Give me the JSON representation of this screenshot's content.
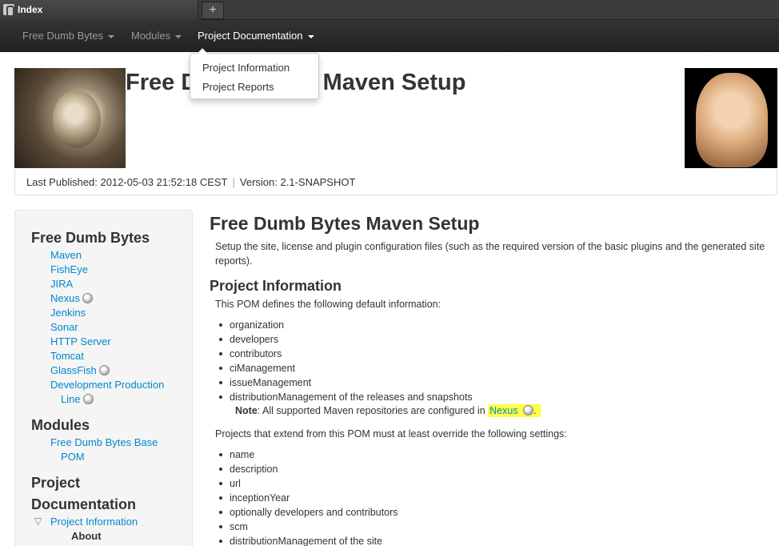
{
  "browser": {
    "tab_title": "Index",
    "new_tab_label": "+"
  },
  "navbar": {
    "items": [
      {
        "label": "Free Dumb Bytes"
      },
      {
        "label": "Modules"
      },
      {
        "label": "Project Documentation"
      }
    ]
  },
  "dropdown": {
    "items": [
      {
        "label": "Project Information"
      },
      {
        "label": "Project Reports"
      }
    ]
  },
  "banner": {
    "title": "Free Dumb Bytes Maven Setup",
    "last_published": "Last Published: 2012-05-03 21:52:18 CEST",
    "separator": "|",
    "version": "Version: 2.1-SNAPSHOT"
  },
  "sidebar": {
    "sections": [
      {
        "header": "Free Dumb Bytes",
        "links": [
          {
            "label": "Maven"
          },
          {
            "label": "FishEye"
          },
          {
            "label": "JIRA"
          },
          {
            "label": "Nexus"
          },
          {
            "label": "Jenkins"
          },
          {
            "label": "Sonar"
          },
          {
            "label": "HTTP Server"
          },
          {
            "label": "Tomcat"
          },
          {
            "label": "GlassFish"
          },
          {
            "label": "Development Production",
            "label2": "Line"
          }
        ]
      },
      {
        "header": "Modules",
        "links": [
          {
            "label": "Free Dumb Bytes Base",
            "label2": "POM"
          }
        ]
      },
      {
        "header": "Project",
        "header2": "Documentation",
        "links": [
          {
            "label": "Project Information"
          }
        ],
        "active": "About",
        "arrow": "▽"
      }
    ]
  },
  "main": {
    "title": "Free Dumb Bytes Maven Setup",
    "intro": "Setup the site, license and plugin configuration files (such as the required version of the basic plugins and the generated site reports).",
    "section_title": "Project Information",
    "section_intro": "This POM defines the following default information:",
    "defaults": [
      "organization",
      "developers",
      "contributors",
      "ciManagement",
      "issueManagement",
      "distributionManagement of the releases and snapshots"
    ],
    "note_label": "Note",
    "note_text": ": All supported Maven repositories are configured in",
    "note_link": "Nexus",
    "note_end": ".",
    "override_intro": "Projects that extend from this POM must at least override the following settings:",
    "overrides": [
      "name",
      "description",
      "url",
      "inceptionYear",
      "optionally developers and contributors",
      "scm",
      "distributionManagement of the site"
    ]
  },
  "colors": {
    "link": "#0088cc",
    "highlight": "#ffff44",
    "navbar": "#222222"
  }
}
